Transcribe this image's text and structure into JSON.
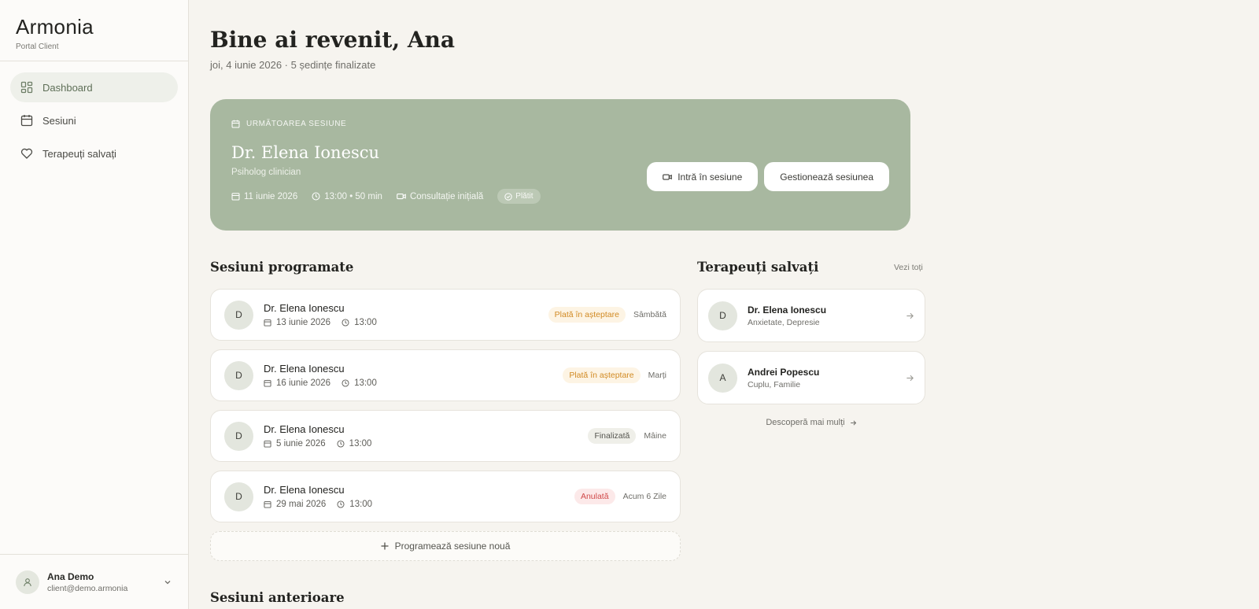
{
  "brand": {
    "name": "Armonia",
    "subtitle": "Portal Client"
  },
  "nav": [
    {
      "label": "Dashboard",
      "icon": "grid-icon",
      "active": true
    },
    {
      "label": "Sesiuni",
      "icon": "calendar-icon"
    },
    {
      "label": "Terapeuți salvați",
      "icon": "heart-icon"
    }
  ],
  "user": {
    "name": "Ana Demo",
    "email": "client@demo.armonia"
  },
  "header": {
    "title": "Bine ai revenit, Ana",
    "subtitle": "joi, 4 iunie 2026 · 5 ședințe finalizate"
  },
  "next_session": {
    "label": "URMĂTOAREA SESIUNE",
    "therapist": "Dr. Elena Ionescu",
    "role": "Psiholog clinician",
    "date": "11 iunie 2026",
    "time": "13:00 • 50 min",
    "type": "Consultație inițială",
    "status": "Plătit",
    "join_label": "Intră în sesiune",
    "manage_label": "Gestionează sesiunea"
  },
  "scheduled": {
    "title": "Sesiuni programate",
    "items": [
      {
        "initial": "D",
        "name": "Dr. Elena Ionescu",
        "date": "13 iunie 2026",
        "time": "13:00",
        "status": "Plată în așteptare",
        "status_kind": "pending",
        "when": "Sâmbătă"
      },
      {
        "initial": "D",
        "name": "Dr. Elena Ionescu",
        "date": "16 iunie 2026",
        "time": "13:00",
        "status": "Plată în așteptare",
        "status_kind": "pending",
        "when": "Marți"
      },
      {
        "initial": "D",
        "name": "Dr. Elena Ionescu",
        "date": "5 iunie 2026",
        "time": "13:00",
        "status": "Finalizată",
        "status_kind": "done",
        "when": "Mâine"
      },
      {
        "initial": "D",
        "name": "Dr. Elena Ionescu",
        "date": "29 mai 2026",
        "time": "13:00",
        "status": "Anulată",
        "status_kind": "cancel",
        "when": "Acum 6 Zile"
      }
    ],
    "add_label": "Programează sesiune nouă"
  },
  "saved": {
    "title": "Terapeuți salvați",
    "see_all": "Vezi toți",
    "items": [
      {
        "initial": "D",
        "name": "Dr. Elena Ionescu",
        "tags": "Anxietate, Depresie"
      },
      {
        "initial": "A",
        "name": "Andrei Popescu",
        "tags": "Cuplu, Familie"
      }
    ],
    "discover": "Descoperă mai mulți"
  },
  "past": {
    "title": "Sesiuni anterioare"
  },
  "colors": {
    "accent": "#a8b8a0",
    "pending": "#d18a23",
    "cancel": "#d04a4a"
  }
}
